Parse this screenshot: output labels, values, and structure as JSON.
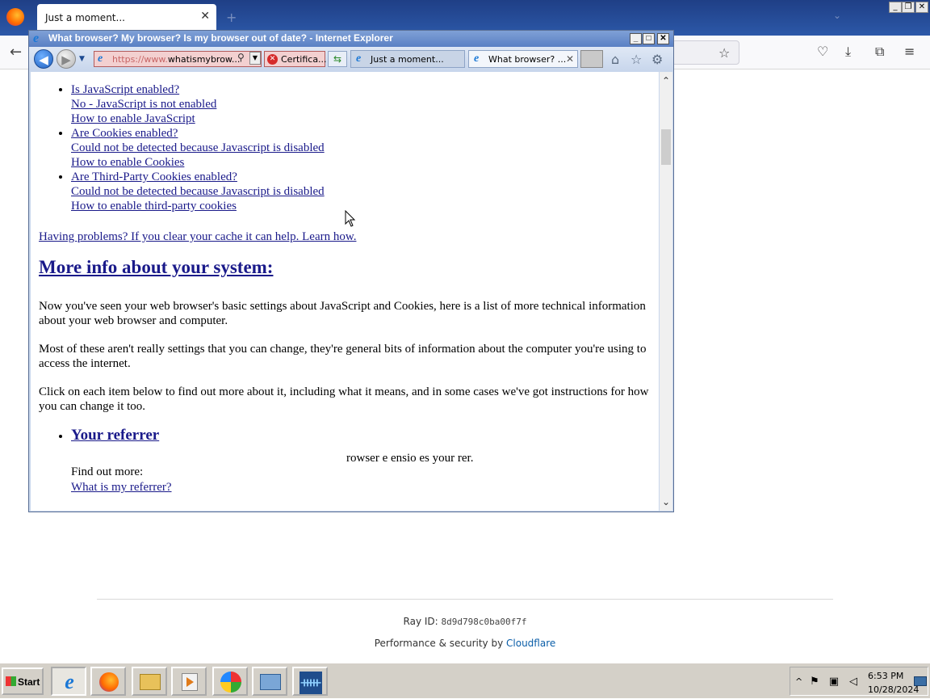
{
  "firefox": {
    "tab_title": "Just a moment...",
    "tab_close": "✕",
    "new_tab": "+",
    "list_tabs": "⌄",
    "caption_min": "_",
    "caption_restore": "❐",
    "caption_close": "✕",
    "back": "←",
    "star": "☆",
    "toolbar_icons": [
      "pocket-icon",
      "download-icon",
      "extensions-icon",
      "menu-icon"
    ],
    "toolbar_glyphs": [
      "♡",
      "⤓",
      "⧉",
      "≡"
    ]
  },
  "cloudflare": {
    "ray_label": "Ray ID: ",
    "ray_id": "8d9d798c0ba00f7f",
    "perf_prefix": "Performance & security by ",
    "perf_link": "Cloudflare"
  },
  "ie": {
    "title": "What browser? My browser? Is my browser out of date? - Internet Explorer",
    "title_icon": "e",
    "caption_min": "_",
    "caption_max": "□",
    "caption_close": "✕",
    "back": "◀",
    "forward": "▶",
    "history_dropdown": "▼",
    "address_proto": "https://www.",
    "address_host": "whatismybrow...",
    "address_search": "⚲",
    "address_dropdown": "▼",
    "cert_label": "Certifica...",
    "cert_icon": "✕",
    "refresh": "⇆",
    "tab1_label": "Just a moment...",
    "tab2_label": "What browser? ...",
    "tab2_close": "✕",
    "home": "⌂",
    "favorites": "☆",
    "tools": "⚙",
    "scroll_up": "⌃",
    "scroll_down": "⌄"
  },
  "content": {
    "links": [
      "Is JavaScript enabled?",
      "No - JavaScript is not enabled",
      "How to enable JavaScript",
      "Are Cookies enabled?",
      "Could not be detected because Javascript is disabled",
      "How to enable Cookies",
      "Are Third-Party Cookies enabled?",
      "Could not be detected because Javascript is disabled",
      "How to enable third-party cookies"
    ],
    "problems_link": "Having problems? If you clear your cache it can help. Learn how.",
    "more_info_heading": "More info about your system:",
    "para1": "Now you've seen your web browser's basic settings about JavaScript and Cookies, here is a list of more technical information about your web browser and computer.",
    "para2": "Most of these aren't really settings that you can change, they're general bits of information about the computer you're using to access the internet.",
    "para3": "Click on each item below to find out more about it, including what it means, and in some cases we've got instructions for how you can change it too.",
    "referrer_heading": "Your referrer",
    "referrer_desc_fragment": "rowser e  ensio          es your        rer.",
    "find_out_more": "Find out more:",
    "what_referrer_link": "What is my referrer?"
  },
  "taskbar": {
    "start_label": "Start",
    "apps": [
      "internet-explorer",
      "firefox",
      "file-explorer",
      "media-player",
      "windows-update",
      "server-manager",
      "system-users"
    ],
    "tray_arrow": "^",
    "time": "6:53 PM",
    "date": "10/28/2024"
  }
}
